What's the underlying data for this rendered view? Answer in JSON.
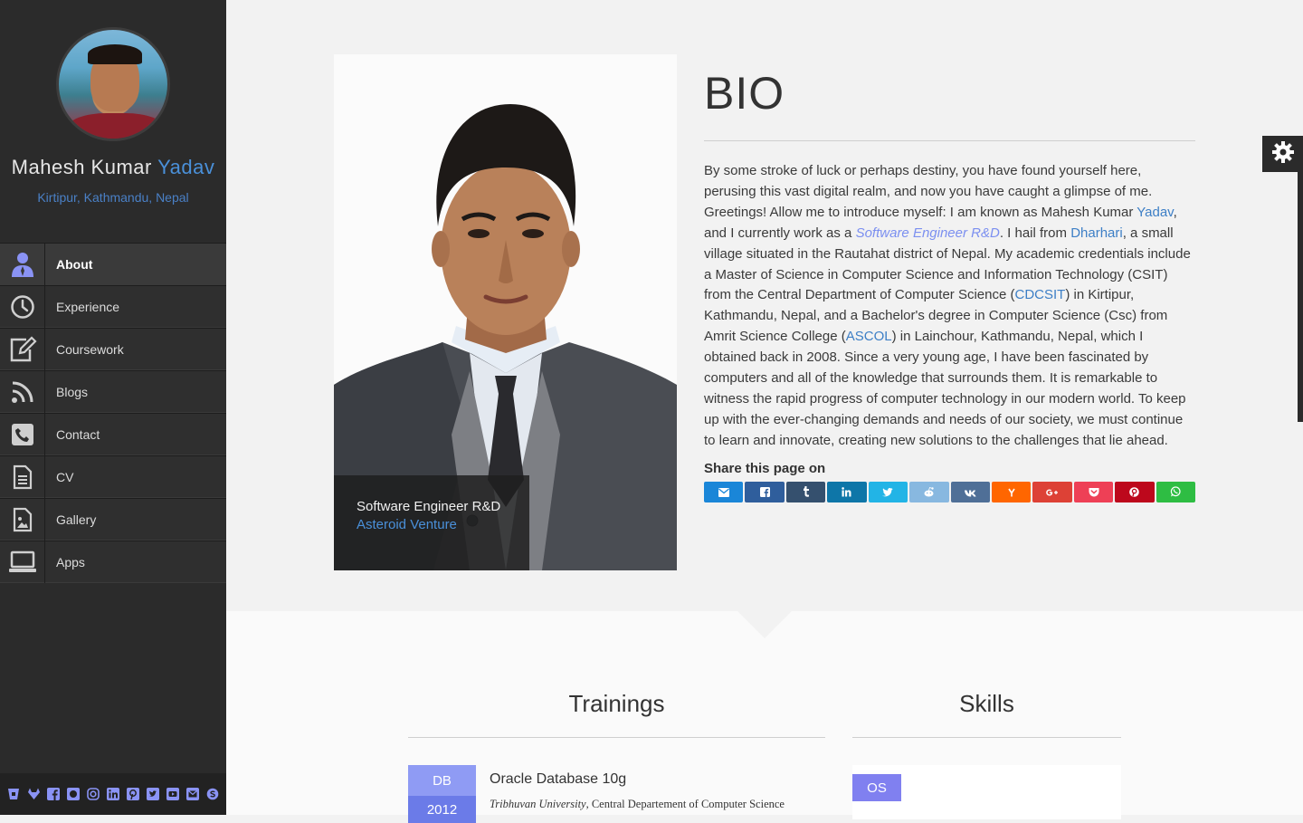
{
  "profile": {
    "first_name": "Mahesh Kumar",
    "last_name": "Yadav",
    "location": "Kirtipur, Kathmandu, Nepal"
  },
  "nav": {
    "items": [
      {
        "label": "About",
        "icon": "user-icon",
        "active": true
      },
      {
        "label": "Experience",
        "icon": "clock-icon"
      },
      {
        "label": "Coursework",
        "icon": "edit-icon"
      },
      {
        "label": "Blogs",
        "icon": "rss-icon"
      },
      {
        "label": "Contact",
        "icon": "phone-icon"
      },
      {
        "label": "CV",
        "icon": "document-icon"
      },
      {
        "label": "Gallery",
        "icon": "image-icon"
      },
      {
        "label": "Apps",
        "icon": "laptop-icon"
      }
    ]
  },
  "social_icons": [
    "bitbucket-icon",
    "gitlab-icon",
    "facebook-icon",
    "github-icon",
    "instagram-icon",
    "linkedin-icon",
    "pinterest-icon",
    "twitter-icon",
    "youtube-icon",
    "email-icon",
    "skype-icon"
  ],
  "photo_caption": {
    "title": "Software Engineer R&D",
    "company": "Asteroid Venture"
  },
  "bio": {
    "heading": "BIO",
    "p1": "By some stroke of luck or perhaps destiny, you have found yourself here, perusing this vast digital realm, and now you have caught a glimpse of me. Greetings! Allow me to introduce myself: I am known as Mahesh Kumar ",
    "link_name": "Yadav",
    "p2": ", and I currently work as a ",
    "link_role": "Software Engineer R&D",
    "p3": ". I hail from ",
    "link_place": "Dharhari",
    "p4": ", a small village situated in the Rautahat district of Nepal. My academic credentials include a Master of Science in Computer Science and Information Technology (CSIT) from the Central Department of Computer Science (",
    "link_cdcsit": "CDCSIT",
    "p5": ") in Kirtipur, Kathmandu, Nepal, and a Bachelor's degree in Computer Science (Csc) from Amrit Science College (",
    "link_ascol": "ASCOL",
    "p6": ") in Lainchour, Kathmandu, Nepal, which I obtained back in 2008. Since a very young age, I have been fascinated by computers and all of the knowledge that surrounds them. It is remarkable to witness the rapid progress of computer technology in our modern world. To keep up with the ever-changing demands and needs of our society, we must continue to learn and innovate, creating new solutions to the challenges that lie ahead."
  },
  "share": {
    "title": "Share this page on",
    "buttons": [
      {
        "icon": "email-icon",
        "color": "#1a86d8"
      },
      {
        "icon": "facebook-icon",
        "color": "#2f5e9c"
      },
      {
        "icon": "tumblr-icon",
        "color": "#35506e"
      },
      {
        "icon": "linkedin-icon",
        "color": "#0e76a8"
      },
      {
        "icon": "twitter-icon",
        "color": "#22b4e6"
      },
      {
        "icon": "reddit-icon",
        "color": "#88b8e0"
      },
      {
        "icon": "vk-icon",
        "color": "#4f6f97"
      },
      {
        "icon": "hackernews-icon",
        "color": "#ff6600"
      },
      {
        "icon": "googleplus-icon",
        "color": "#dd4136"
      },
      {
        "icon": "pocket-icon",
        "color": "#ee4056"
      },
      {
        "icon": "pinterest-icon",
        "color": "#bd081c"
      },
      {
        "icon": "whatsapp-icon",
        "color": "#2ebd43"
      }
    ]
  },
  "trainings": {
    "title": "Trainings",
    "items": [
      {
        "category": "DB",
        "year": "2012",
        "name": "Oracle Database 10g",
        "institution": "Tribhuvan University",
        "department": ", Central Departement of Computer Science"
      }
    ]
  },
  "skills": {
    "title": "Skills",
    "items": [
      {
        "category": "OS"
      }
    ]
  }
}
